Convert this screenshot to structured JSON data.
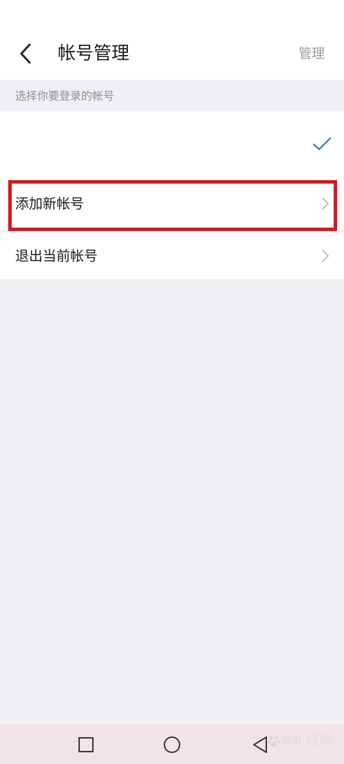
{
  "header": {
    "title": "帐号管理",
    "manage_label": "管理",
    "back_icon": "chevron-left-icon"
  },
  "section": {
    "hint": "选择你要登录的帐号"
  },
  "list": {
    "current_account_selected": true,
    "add_account_label": "添加新帐号",
    "logout_label": "退出当前帐号"
  },
  "highlight": {
    "color": "#d9151e",
    "target": "添加新帐号"
  },
  "colors": {
    "accent_check": "#3b6fc2",
    "background": "#efeff4",
    "nav_bar": "#f1e4e6"
  },
  "watermark": {
    "text": "Bai 经验"
  }
}
